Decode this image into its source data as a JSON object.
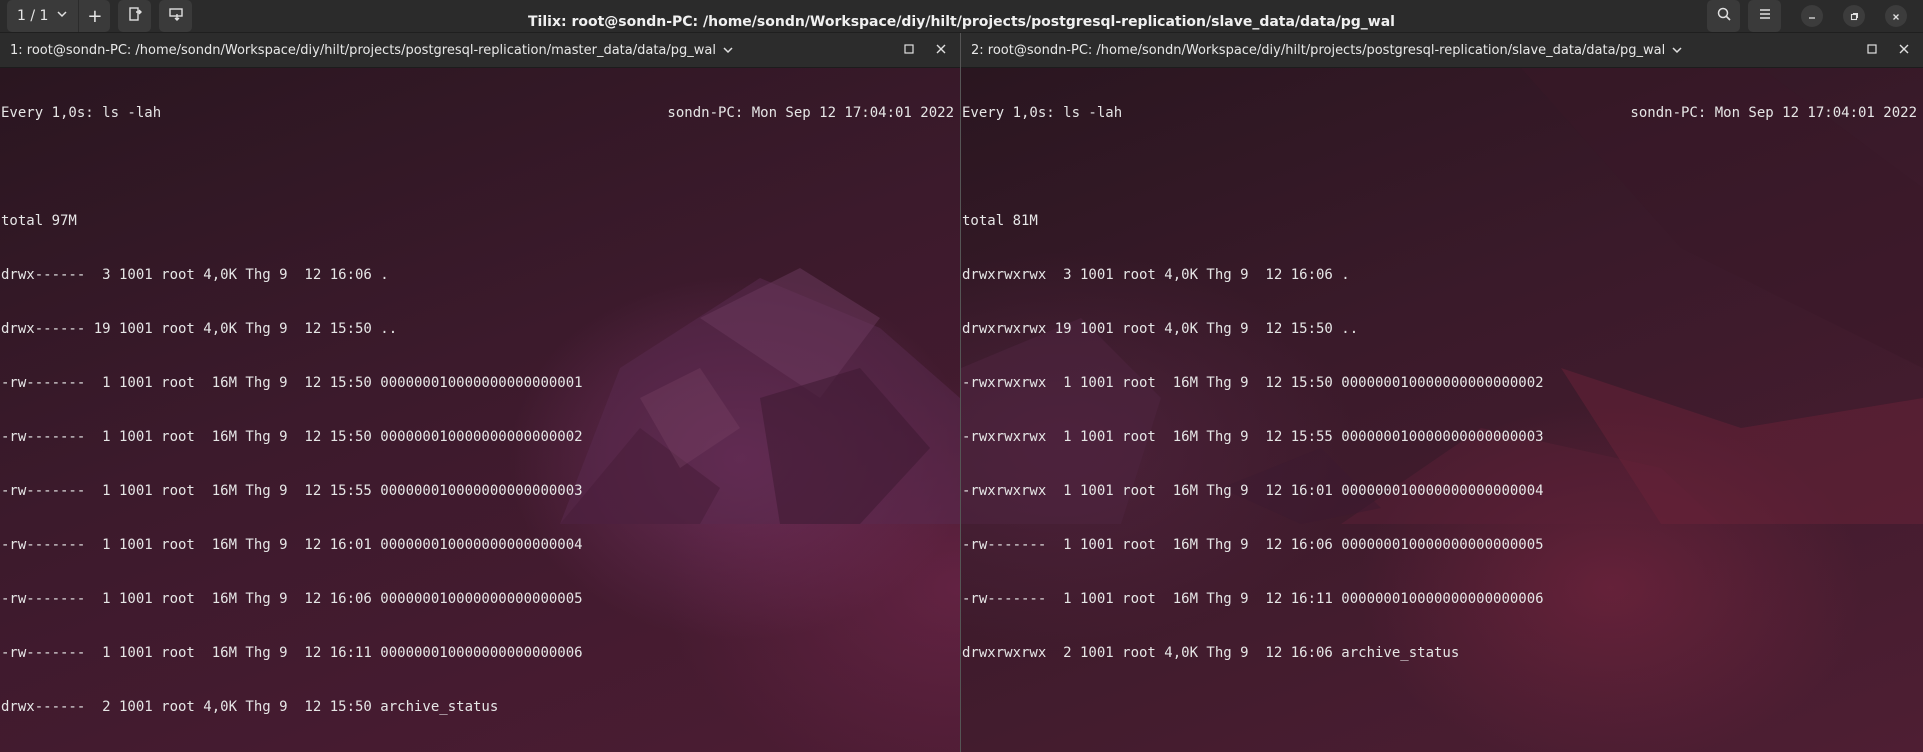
{
  "window": {
    "title": "Tilix: root@sondn-PC: /home/sondn/Workspace/diy/hilt/projects/postgresql-replication/slave_data/data/pg_wal",
    "session_label": "1 / 1",
    "plus": "+"
  },
  "panes": [
    {
      "title": "1: root@sondn-PC: /home/sondn/Workspace/diy/hilt/projects/postgresql-replication/master_data/data/pg_wal",
      "watch_cmd": "Every 1,0s: ls -lah",
      "watch_host": "sondn-PC: Mon Sep 12 17:04:01 2022",
      "total": "total 97M",
      "lines": [
        "drwx------  3 1001 root 4,0K Thg 9  12 16:06 .",
        "drwx------ 19 1001 root 4,0K Thg 9  12 15:50 ..",
        "-rw-------  1 1001 root  16M Thg 9  12 15:50 000000010000000000000001",
        "-rw-------  1 1001 root  16M Thg 9  12 15:50 000000010000000000000002",
        "-rw-------  1 1001 root  16M Thg 9  12 15:55 000000010000000000000003",
        "-rw-------  1 1001 root  16M Thg 9  12 16:01 000000010000000000000004",
        "-rw-------  1 1001 root  16M Thg 9  12 16:06 000000010000000000000005",
        "-rw-------  1 1001 root  16M Thg 9  12 16:11 000000010000000000000006",
        "drwx------  2 1001 root 4,0K Thg 9  12 15:50 archive_status"
      ]
    },
    {
      "title": "2: root@sondn-PC: /home/sondn/Workspace/diy/hilt/projects/postgresql-replication/slave_data/data/pg_wal",
      "watch_cmd": "Every 1,0s: ls -lah",
      "watch_host": "sondn-PC: Mon Sep 12 17:04:01 2022",
      "total": "total 81M",
      "lines": [
        "drwxrwxrwx  3 1001 root 4,0K Thg 9  12 16:06 .",
        "drwxrwxrwx 19 1001 root 4,0K Thg 9  12 15:50 ..",
        "-rwxrwxrwx  1 1001 root  16M Thg 9  12 15:50 000000010000000000000002",
        "-rwxrwxrwx  1 1001 root  16M Thg 9  12 15:55 000000010000000000000003",
        "-rwxrwxrwx  1 1001 root  16M Thg 9  12 16:01 000000010000000000000004",
        "-rw-------  1 1001 root  16M Thg 9  12 16:06 000000010000000000000005",
        "-rw-------  1 1001 root  16M Thg 9  12 16:11 000000010000000000000006",
        "drwxrwxrwx  2 1001 root 4,0K Thg 9  12 16:06 archive_status"
      ]
    }
  ],
  "icons": {
    "session_dropdown": "chevron-down-icon",
    "add_session": "plus-icon",
    "add_terminal_right": "split-right-icon",
    "add_terminal_down": "split-down-icon",
    "find": "search-icon",
    "menu": "hamburger-menu-icon",
    "minimize": "minimize-icon",
    "maximize": "maximize-icon",
    "close": "close-icon"
  },
  "colors": {
    "terminal_fg": "#e6e6e6",
    "header_bg": "#2b2b2b",
    "terminal_bg_accent": "#4c1c33"
  }
}
